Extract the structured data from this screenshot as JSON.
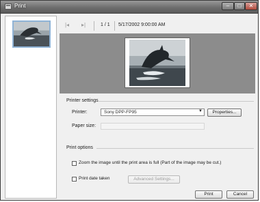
{
  "window": {
    "title": "Print"
  },
  "toolbar": {
    "page_count": "1 / 1",
    "timestamp": "5/17/2002 9:00:00 AM"
  },
  "printer_settings": {
    "heading": "Printer settings",
    "printer_label": "Printer:",
    "printer_value": "Sony DPP-FP95",
    "properties_button": "Properties...",
    "paper_size_label": "Paper size:",
    "paper_size_value": ""
  },
  "print_options": {
    "heading": "Print options",
    "zoom_label": "Zoom the image until the print area is full (Part of the image may be cut.)",
    "zoom_checked": false,
    "print_date_label": "Print date taken",
    "print_date_checked": false,
    "advanced_button": "Advanced Settings..."
  },
  "actions": {
    "print_button": "Print",
    "cancel_button": "Cancel"
  },
  "icons": {
    "first_page": "skip-to-first-icon",
    "last_page": "skip-to-last-icon",
    "dropdown": "chevron-down-icon"
  }
}
